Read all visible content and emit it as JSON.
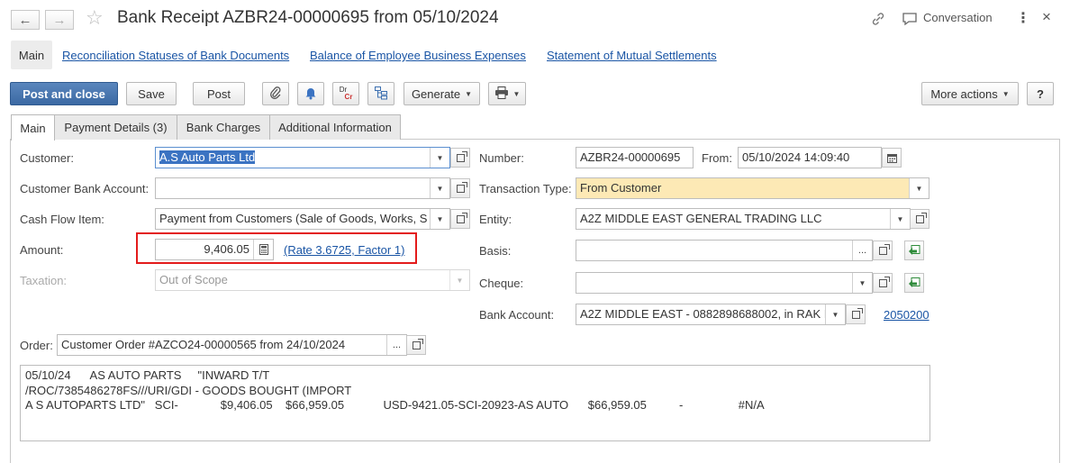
{
  "window": {
    "title": "Bank Receipt AZBR24-00000695 from 05/10/2024",
    "conversation_label": "Conversation",
    "more_icon": "⋮",
    "close_icon": "×"
  },
  "nav_links": {
    "main": "Main",
    "links": [
      "Reconciliation Statuses of Bank Documents",
      "Balance of Employee Business Expenses",
      "Statement of Mutual Settlements"
    ]
  },
  "toolbar": {
    "post_close": "Post and close",
    "save": "Save",
    "post": "Post",
    "drcr_top": "Dr",
    "drcr_bottom": "Cr",
    "generate": "Generate",
    "more_actions": "More actions",
    "help": "?"
  },
  "tabs": [
    "Main",
    "Payment Details (3)",
    "Bank Charges",
    "Additional Information"
  ],
  "form": {
    "customer_label": "Customer:",
    "customer_value": "A.S Auto Parts Ltd",
    "customer_bank_label": "Customer Bank Account:",
    "customer_bank_value": "",
    "cash_flow_label": "Cash Flow Item:",
    "cash_flow_value": "Payment from Customers (Sale of Goods, Works, S",
    "amount_label": "Amount:",
    "amount_value": "9,406.05",
    "rate_link": "(Rate 3.6725, Factor 1)",
    "taxation_label": "Taxation:",
    "taxation_value": "Out of Scope",
    "number_label": "Number:",
    "number_value": "AZBR24-00000695",
    "from_label": "From:",
    "from_value": "05/10/2024 14:09:40",
    "transaction_type_label": "Transaction Type:",
    "transaction_type_value": "From Customer",
    "entity_label": "Entity:",
    "entity_value": "A2Z MIDDLE EAST GENERAL TRADING LLC",
    "basis_label": "Basis:",
    "basis_value": "",
    "cheque_label": "Cheque:",
    "cheque_value": "",
    "bank_account_label": "Bank Account:",
    "bank_account_value": "A2Z MIDDLE EAST - 0882898688002, in RAK I",
    "bank_account_link": "2050200",
    "order_label": "Order:",
    "order_value": "Customer Order #AZCO24-00000565 from 24/10/2024",
    "ellipsis": "...",
    "memo": "05/10/24      AS AUTO PARTS     \"INWARD T/T\n/ROC/7385486278FS///URI/GDI - GOODS BOUGHT (IMPORT\nA S AUTOPARTS LTD\"   SCI-             $9,406.05    $66,959.05            USD-9421.05-SCI-20923-AS AUTO      $66,959.05          -                 #N/A"
  },
  "colors": {
    "primary": "#3b69a3",
    "link": "#1a55a5",
    "highlight_field": "#fde9b5",
    "annotation": "#e31b1b"
  }
}
